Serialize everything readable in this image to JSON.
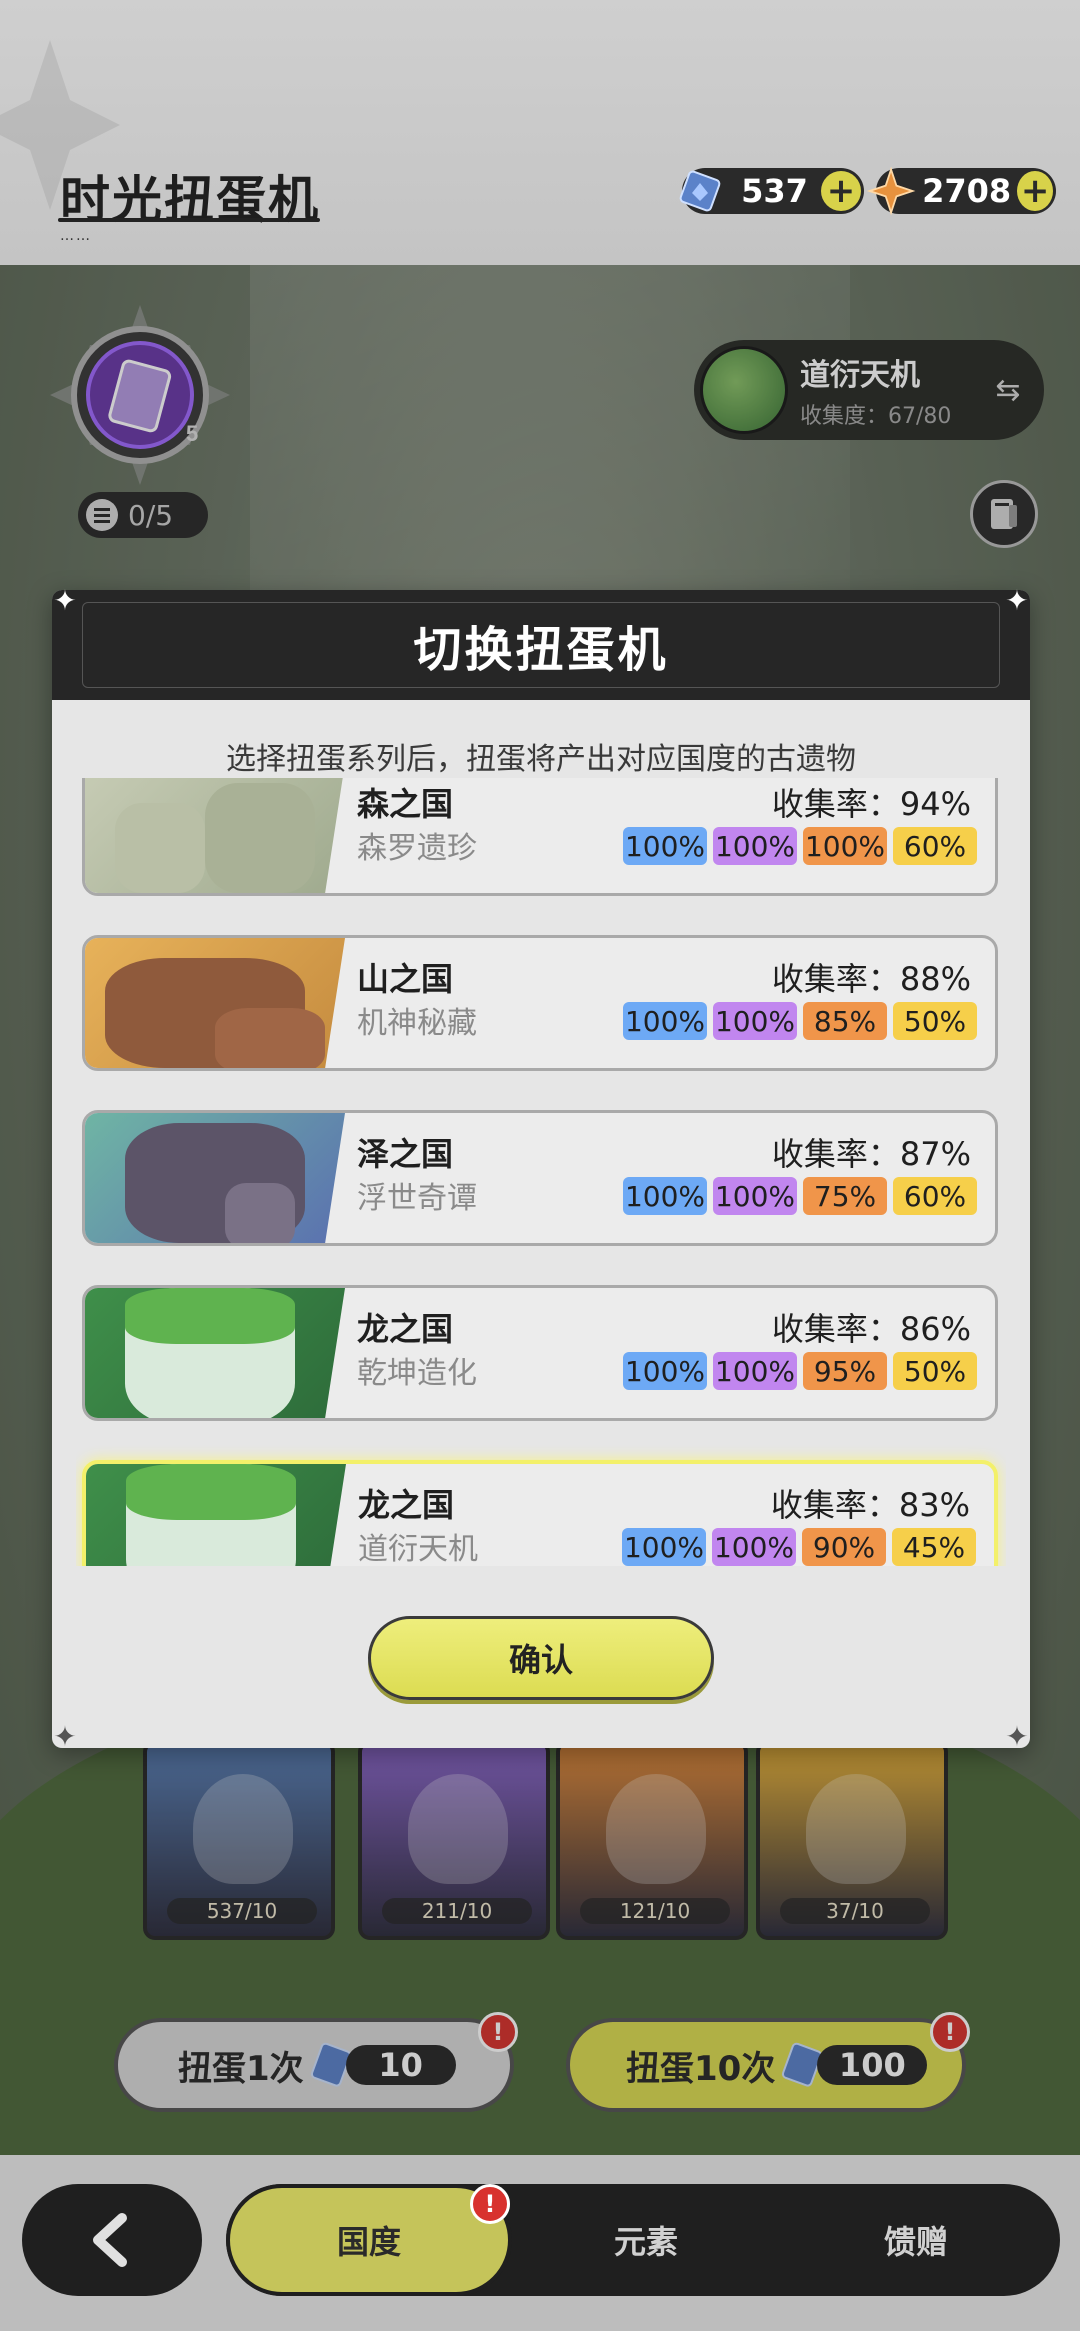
{
  "header": {
    "title": "时光扭蛋机",
    "title_dots": "……",
    "currencies": [
      {
        "icon": "gem-ticket-icon",
        "value": "537"
      },
      {
        "icon": "star-crystal-icon",
        "value": "2708"
      }
    ]
  },
  "machine": {
    "avatar_level": "5",
    "progress": "0/5",
    "series_name": "道衍天机",
    "series_collection": "收集度：67/80"
  },
  "modal": {
    "title": "切换扭蛋机",
    "description": "选择扭蛋系列后，扭蛋将产出对应国度的古遗物",
    "rows": [
      {
        "name": "森之国",
        "sub": "森罗遗珍",
        "rate": "收集率：94%",
        "badges": [
          "100%",
          "100%",
          "100%",
          "60%"
        ],
        "selected": false
      },
      {
        "name": "山之国",
        "sub": "机神秘藏",
        "rate": "收集率：88%",
        "badges": [
          "100%",
          "100%",
          "85%",
          "50%"
        ],
        "selected": false
      },
      {
        "name": "泽之国",
        "sub": "浮世奇谭",
        "rate": "收集率：87%",
        "badges": [
          "100%",
          "100%",
          "75%",
          "60%"
        ],
        "selected": false
      },
      {
        "name": "龙之国",
        "sub": "乾坤造化",
        "rate": "收集率：86%",
        "badges": [
          "100%",
          "100%",
          "95%",
          "50%"
        ],
        "selected": false
      },
      {
        "name": "龙之国",
        "sub": "道衍天机",
        "rate": "收集率：83%",
        "badges": [
          "100%",
          "100%",
          "90%",
          "45%"
        ],
        "selected": true
      }
    ],
    "confirm_label": "确认"
  },
  "cards": [
    {
      "count": "537/10",
      "color": "#5a7fb5"
    },
    {
      "count": "211/10",
      "color": "#8a66c9"
    },
    {
      "count": "121/10",
      "color": "#e08a3a"
    },
    {
      "count": "37/10",
      "color": "#e8b23a"
    }
  ],
  "pull_buttons": [
    {
      "label": "扭蛋1次",
      "cost": "10",
      "alert": "!"
    },
    {
      "label": "扭蛋10次",
      "cost": "100",
      "alert": "!"
    }
  ],
  "nav": {
    "tabs": [
      "国度",
      "元素",
      "馈赠"
    ],
    "active_index": 0,
    "alert": "!"
  },
  "colors": {
    "accent_yellow": "#dcdc52",
    "badge_blue": "#6da9f5",
    "badge_purple": "#c186ef",
    "badge_orange": "#f0954a",
    "badge_yellow": "#f6cf4a",
    "alert_red": "#d8322e"
  }
}
